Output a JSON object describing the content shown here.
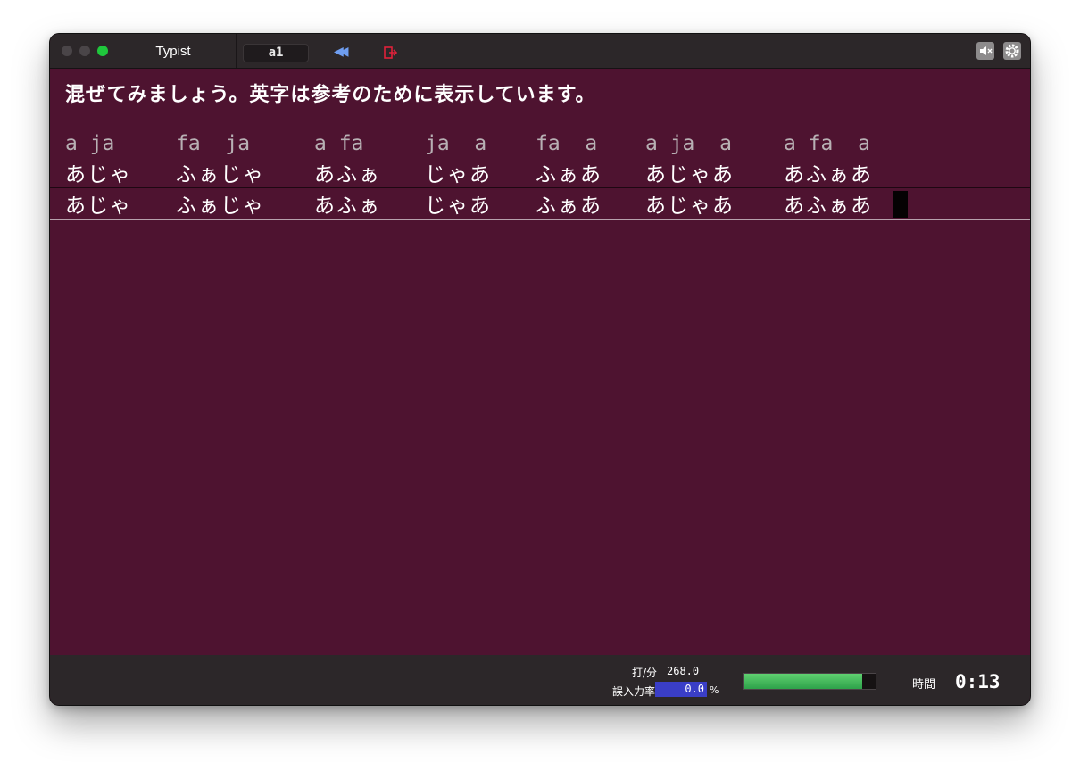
{
  "titlebar": {
    "app_title": "Typist",
    "mode_field": "a1",
    "rewind_icon": "rewind-icon",
    "exit_icon": "exit-icon",
    "mute_icon": "speaker-mute-icon",
    "settings_icon": "gear-icon"
  },
  "instruction": "混ぜてみましょう。英字は参考のために表示しています。",
  "exercise": {
    "romaji": [
      "a ja",
      "fa  ja",
      "a fa",
      "ja  a",
      "fa  a",
      "a ja  a",
      "a fa  a"
    ],
    "target": [
      "あじゃ",
      "ふぁじゃ",
      "あふぁ",
      "じゃあ",
      "ふぁあ",
      "あじゃあ",
      "あふぁあ"
    ],
    "typed": [
      "あじゃ",
      "ふぁじゃ",
      "あふぁ",
      "じゃあ",
      "ふぁあ",
      "あじゃあ",
      "あふぁあ"
    ]
  },
  "status": {
    "speed_label": "打/分",
    "speed_value": "268.0",
    "error_label": "誤入力率",
    "error_value": "0.0",
    "error_unit": "%",
    "progress_fraction": 0.9,
    "time_label": "時間",
    "time_value": "0:13"
  },
  "colors": {
    "background": "#4e1330",
    "bar": "#2c2729",
    "progress": "#3cb85a",
    "error_bar": "#3a3ec7",
    "traffic_green": "#1fc73c"
  }
}
